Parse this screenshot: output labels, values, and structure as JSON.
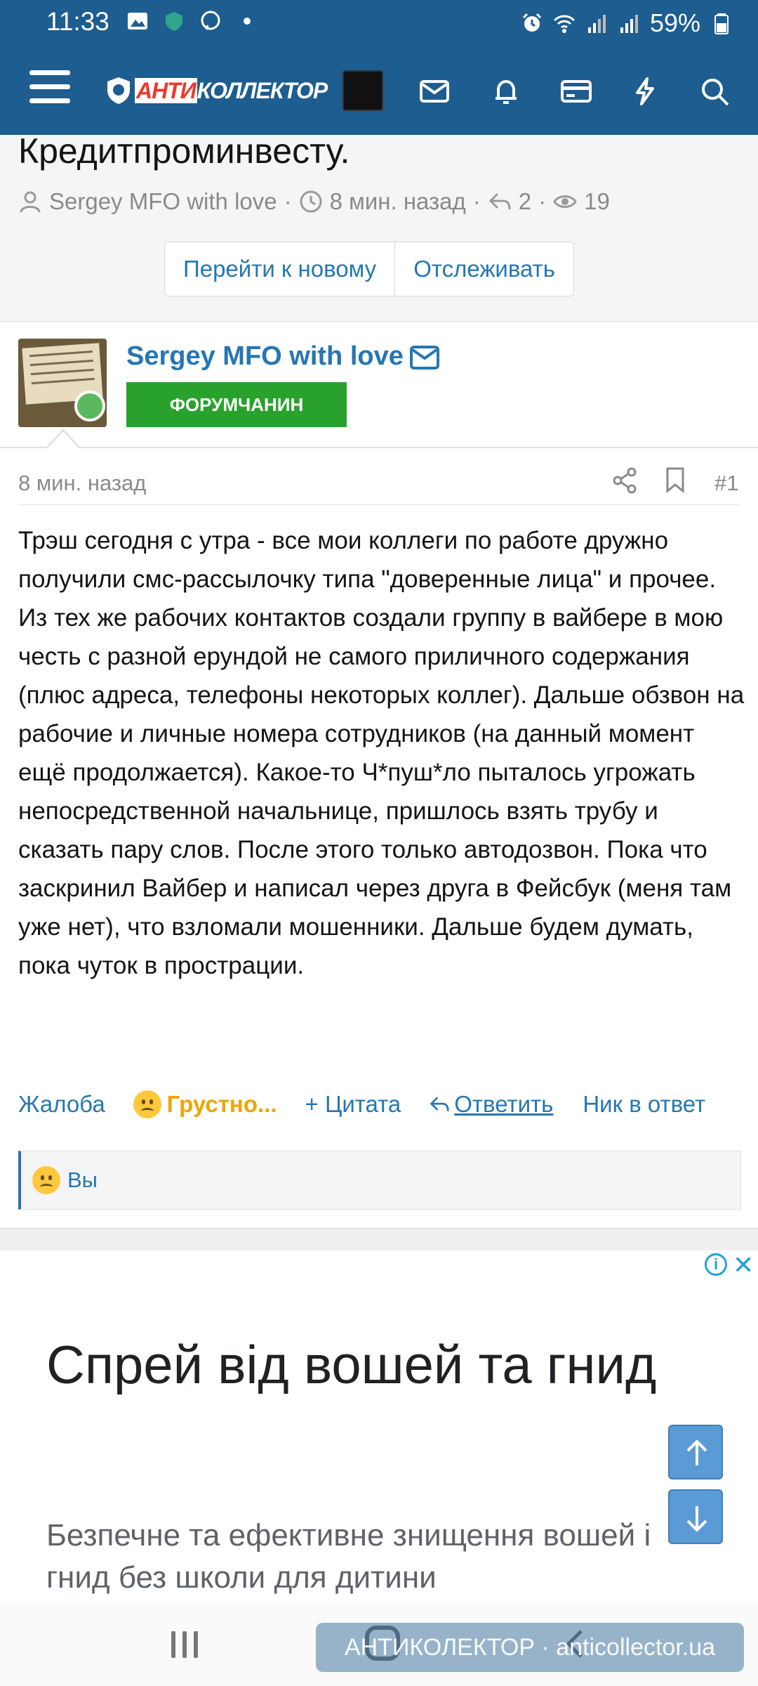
{
  "status_bar": {
    "time": "11:33",
    "battery": "59%"
  },
  "header": {
    "logo_part1": "АНТИ",
    "logo_part2": "КОЛЛЕКТОР"
  },
  "thread": {
    "title": "Кредитпроминвесту.",
    "author": "Sergey MFO with love",
    "time": "8 мин. назад",
    "replies": "2",
    "views": "19",
    "btn_new": "Перейти к новому",
    "btn_watch": "Отслеживать"
  },
  "post": {
    "username": "Sergey MFO with love",
    "user_title": "ФОРУМЧАНИН",
    "time": "8 мин. назад",
    "number": "#1",
    "body": "Трэш сегодня с утра - все мои коллеги по работе дружно получили смс-рассылочку типа \"доверенные лица\" и прочее. Из тех же рабочих контактов создали группу в вайбере в мою честь с разной ерундой не самого приличного содержания (плюс адреса, телефоны некоторых коллег). Дальше обзвон на рабочие и личные номера сотрудников (на данный момент ещё продолжается). Какое-то Ч*пуш*ло пыталось угрожать непосредственной начальнице, пришлось взять трубу и сказать пару слов. После этого только автодозвон. Пока что заскринил Вайбер и написал через друга в Фейсбук (меня там уже нет), что взломали мошенники. Дальше будем думать, пока чуток в прострации.",
    "actions": {
      "report": "Жалоба",
      "reaction": "Грустно...",
      "quote": "+ Цитата",
      "reply": "Ответить",
      "mention": "Ник в ответ"
    },
    "reaction_summary": "Вы"
  },
  "ad": {
    "headline": "Спрей від вошей та гнид",
    "subtext": "Безпечне та ефективне знищення вошей і гнид без школи для дитини"
  },
  "watermark": "АНТИКОЛЕКТОР · anticollector.ua"
}
